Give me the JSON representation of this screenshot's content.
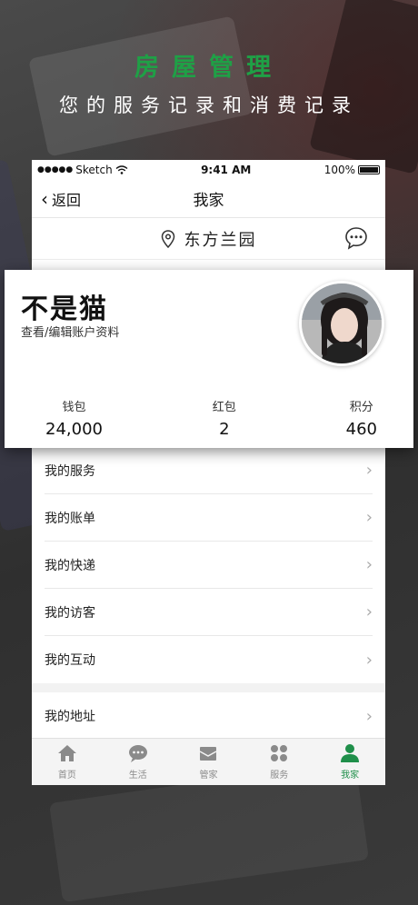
{
  "hero": {
    "title": "房屋管理",
    "subtitle": "您的服务记录和消费记录"
  },
  "status_bar": {
    "carrier": "Sketch",
    "time": "9:41 AM",
    "battery": "100%"
  },
  "nav": {
    "back_label": "返回",
    "title": "我家"
  },
  "location": {
    "name": "东方兰园"
  },
  "profile": {
    "name": "不是猫",
    "edit_label": "查看/编辑账户资料",
    "stats": [
      {
        "label": "钱包",
        "value": "24,000"
      },
      {
        "label": "红包",
        "value": "2"
      },
      {
        "label": "积分",
        "value": "460"
      }
    ]
  },
  "menu": {
    "group1": [
      "我的服务",
      "我的账单",
      "我的快递",
      "我的访客",
      "我的互动"
    ],
    "group2": [
      "我的地址"
    ]
  },
  "tabbar": {
    "items": [
      {
        "label": "首页",
        "icon": "home-icon"
      },
      {
        "label": "生活",
        "icon": "chat-icon"
      },
      {
        "label": "管家",
        "icon": "mail-icon"
      },
      {
        "label": "服务",
        "icon": "grid-icon"
      },
      {
        "label": "我家",
        "icon": "person-icon"
      }
    ],
    "active_index": 4
  },
  "colors": {
    "accent_green": "#1f8f4a",
    "hero_green": "#1fa046"
  }
}
